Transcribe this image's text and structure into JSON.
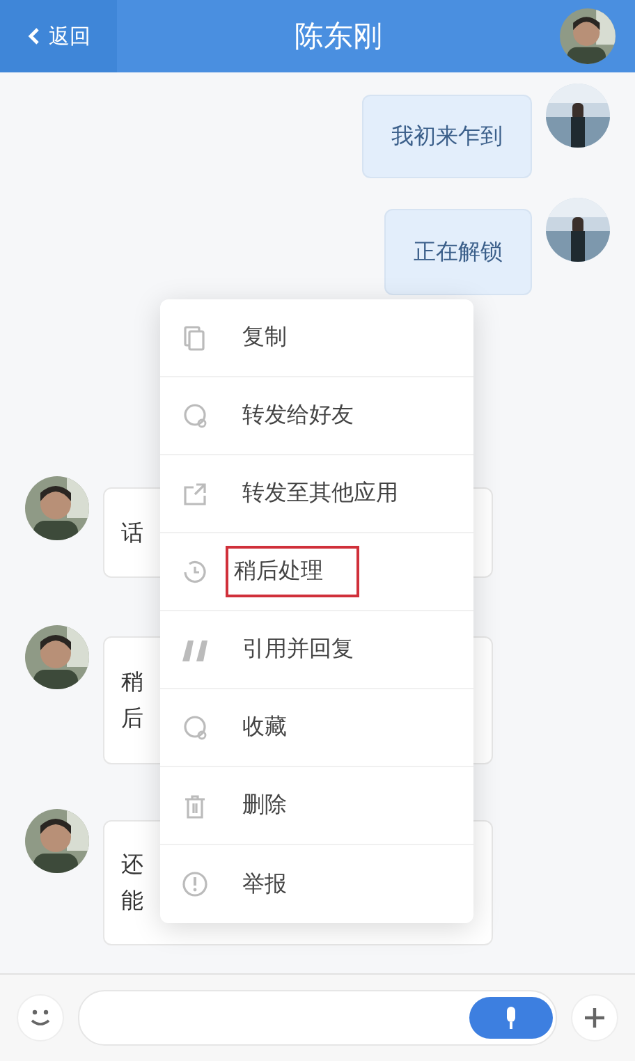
{
  "header": {
    "back": "返回",
    "title": "陈东刚"
  },
  "messages": [
    {
      "kind": "outgoing",
      "lines": [
        "我初来乍到"
      ]
    },
    {
      "kind": "outgoing",
      "lines": [
        "正在解锁"
      ]
    },
    {
      "kind": "incoming",
      "lines": [
        "话"
      ]
    },
    {
      "kind": "incoming",
      "lines": [
        "稍",
        "后"
      ]
    },
    {
      "kind": "incoming",
      "lines": [
        "还",
        "能"
      ]
    }
  ],
  "menu": [
    {
      "label": "复制",
      "highlighted": false
    },
    {
      "label": "转发给好友",
      "highlighted": false
    },
    {
      "label": "转发至其他应用",
      "highlighted": false
    },
    {
      "label": "稍后处理",
      "highlighted": true
    },
    {
      "label": "引用并回复",
      "highlighted": false
    },
    {
      "label": "收藏",
      "highlighted": false
    },
    {
      "label": "删除",
      "highlighted": false
    },
    {
      "label": "举报",
      "highlighted": false
    }
  ]
}
